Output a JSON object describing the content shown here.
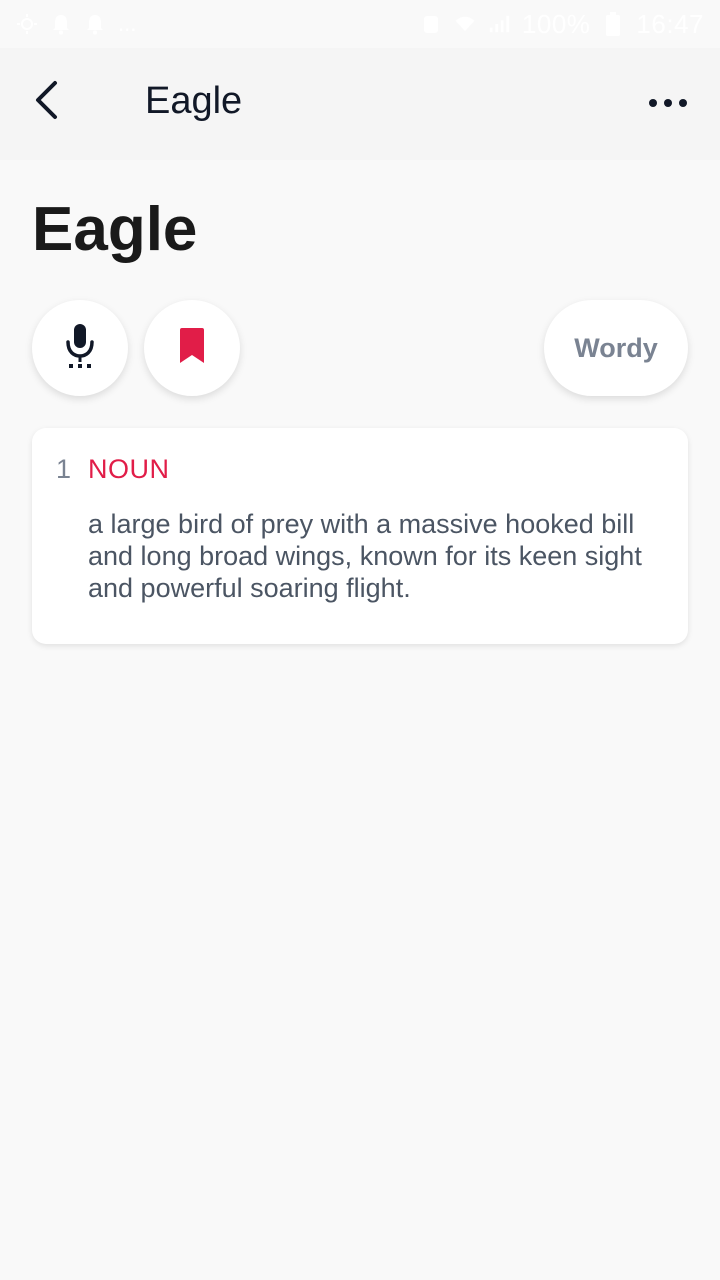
{
  "status_bar": {
    "battery": "100%",
    "time": "16:47",
    "more_notifications": "...",
    "icons": [
      "weather-icon",
      "notification-icon",
      "notification-icon",
      "alarm-icon",
      "wifi-icon",
      "signal-icon",
      "battery-icon"
    ]
  },
  "app_bar": {
    "title": "Eagle",
    "back_icon": "back-arrow-icon",
    "more_icon": "more-horizontal-icon"
  },
  "word": {
    "heading": "Eagle"
  },
  "actions": {
    "pronounce_icon": "microphone-icon",
    "bookmark_icon": "bookmark-icon",
    "bookmark_color": "#e11d48",
    "wordy_label": "Wordy"
  },
  "definitions": [
    {
      "number": "1",
      "part_of_speech": "NOUN",
      "text": "a large bird of prey with a massive hooked bill and long broad wings, known for its keen sight and powerful soaring flight."
    }
  ],
  "colors": {
    "accent": "#e11d48",
    "text_dark": "#111827",
    "text_muted": "#7a8392",
    "background": "#f9f9f9"
  }
}
